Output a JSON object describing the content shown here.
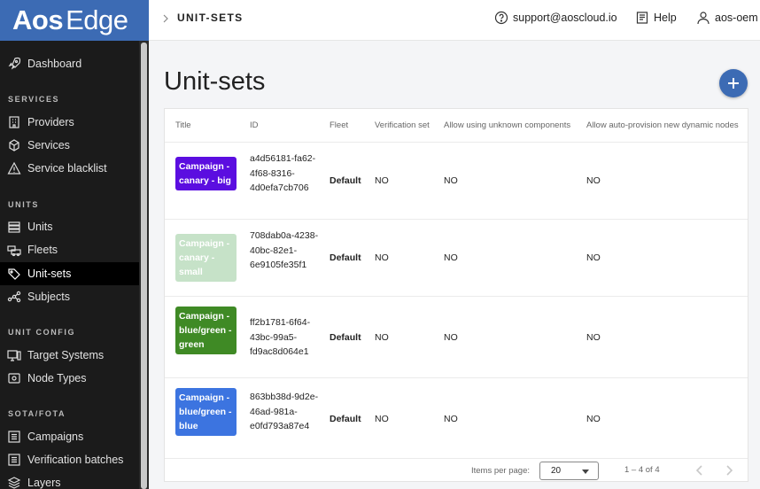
{
  "brand": {
    "word1": "Aos",
    "word2": "Edge",
    "color": "#3c6bb4"
  },
  "sidebar": {
    "items": [
      {
        "label": "Dashboard",
        "icon": "rocket-icon"
      },
      {
        "label": "Providers",
        "icon": "building-icon"
      },
      {
        "label": "Services",
        "icon": "cube-icon"
      },
      {
        "label": "Service blacklist",
        "icon": "warning-icon"
      },
      {
        "label": "Units",
        "icon": "stack-icon"
      },
      {
        "label": "Fleets",
        "icon": "fleet-icon"
      },
      {
        "label": "Unit-sets",
        "icon": "tags-icon",
        "active": true
      },
      {
        "label": "Subjects",
        "icon": "network-icon"
      },
      {
        "label": "Target Systems",
        "icon": "monitor-icon"
      },
      {
        "label": "Node Types",
        "icon": "node-icon"
      },
      {
        "label": "Campaigns",
        "icon": "list-icon"
      },
      {
        "label": "Verification batches",
        "icon": "list-icon"
      },
      {
        "label": "Layers",
        "icon": "layers-icon"
      }
    ],
    "sections": [
      "SERVICES",
      "UNITS",
      "UNIT CONFIG",
      "SOTA/FOTA"
    ]
  },
  "topbar": {
    "breadcrumb": "UNIT-SETS",
    "support": "support@aoscloud.io",
    "help": "Help",
    "user": "aos-oem"
  },
  "page": {
    "title": "Unit-sets"
  },
  "table": {
    "headers": [
      "Title",
      "ID",
      "Fleet",
      "Verification set",
      "Allow using unknown components",
      "Allow auto-provision new dynamic nodes"
    ],
    "rows": [
      {
        "title": "Campaign - canary - big",
        "color": "#5b0ee0",
        "id": "a4d56181-fa62-4f68-8316-4d0efa7cb706",
        "fleet": "Default",
        "verification": "NO",
        "unknown": "NO",
        "autoprov": "NO"
      },
      {
        "title": "Campaign - canary - small",
        "color": "#c6e2c8",
        "id": "708dab0a-4238-40bc-82e1-6e9105fe35f1",
        "fleet": "Default",
        "verification": "NO",
        "unknown": "NO",
        "autoprov": "NO"
      },
      {
        "title": "Campaign - blue/green - green",
        "color": "#3f8a25",
        "id": "ff2b1781-6f64-43bc-99a5-fd9ac8d064e1",
        "fleet": "Default",
        "verification": "NO",
        "unknown": "NO",
        "autoprov": "NO"
      },
      {
        "title": "Campaign - blue/green - blue",
        "color": "#3c74e0",
        "id": "863bb38d-9d2e-46ad-981a-e0fd793a87e4",
        "fleet": "Default",
        "verification": "NO",
        "unknown": "NO",
        "autoprov": "NO"
      }
    ]
  },
  "pagination": {
    "items_per_page_label": "Items per page:",
    "items_per_page": "20",
    "range": "1 – 4 of 4"
  }
}
